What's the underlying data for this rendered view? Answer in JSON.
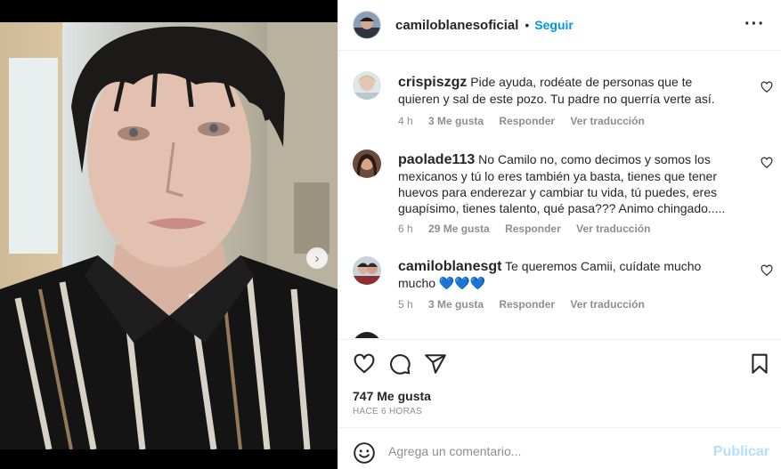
{
  "post": {
    "next_icon": "chevron-right-icon",
    "carousel_total": 2,
    "carousel_active": 0
  },
  "header": {
    "username": "camiloblanesoficial",
    "separator": "•",
    "follow_label": "Seguir",
    "more_icon": "more-horizontal-icon",
    "more_glyph": "···"
  },
  "comments": [
    {
      "username": "crispiszgz",
      "text": "Pide ayuda, rodéate de personas que te quieren y sal de este pozo. Tu padre no querría verte así.",
      "time": "4 h",
      "likes": "3 Me gusta",
      "reply_label": "Responder",
      "translate_label": "Ver traducción"
    },
    {
      "username": "paolade113",
      "text": "No Camilo no, como decimos y somos los mexicanos y tú lo eres también ya basta, tienes que tener huevos para enderezar y cambiar tu vida, tú puedes, eres guapísimo, tienes talento, qué pasa??? Animo chingado.....",
      "time": "6 h",
      "likes": "29 Me gusta",
      "reply_label": "Responder",
      "translate_label": "Ver traducción"
    },
    {
      "username": "camiloblanesgt",
      "text": "Te queremos Camii, cuídate mucho mucho 💙💙💙",
      "time": "5 h",
      "likes": "3 Me gusta",
      "reply_label": "Responder",
      "translate_label": "Ver traducción"
    }
  ],
  "actions": {
    "like_icon": "heart-icon",
    "comment_icon": "comment-icon",
    "share_icon": "send-icon",
    "save_icon": "bookmark-icon"
  },
  "likes_count": "747 Me gusta",
  "time_ago": "HACE 6 HORAS",
  "add_comment": {
    "emoji_icon": "emoji-icon",
    "placeholder": "Agrega un comentario...",
    "publish_label": "Publicar"
  },
  "colors": {
    "accent": "#0095f6",
    "publish_disabled": "#b2dffc",
    "muted": "#8e8e8e",
    "text": "#262626"
  }
}
